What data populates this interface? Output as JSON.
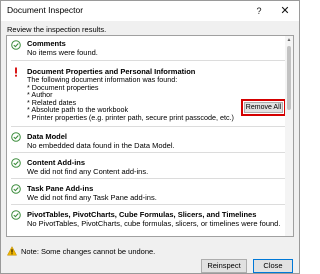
{
  "window": {
    "title": "Document Inspector",
    "help_glyph": "?",
    "close_glyph": "✕"
  },
  "instruction": "Review the inspection results.",
  "sections": [
    {
      "title": "Comments",
      "description": "No items were found.",
      "status": "ok"
    },
    {
      "title": "Document Properties and Personal Information",
      "status": "warning",
      "details": [
        "The following document information was found:",
        "* Document properties",
        "* Author",
        "* Related dates",
        "* Absolute path to the workbook",
        "* Printer properties (e.g. printer path, secure print passcode, etc.)"
      ],
      "action_label": "Remove All"
    },
    {
      "title": "Data Model",
      "description": "No embedded data found in the Data Model.",
      "status": "ok"
    },
    {
      "title": "Content Add-ins",
      "description": "We did not find any Content add-ins.",
      "status": "ok"
    },
    {
      "title": "Task Pane Add-ins",
      "description": "We did not find any Task Pane add-ins.",
      "status": "ok"
    },
    {
      "title": "PivotTables, PivotCharts, Cube Formulas, Slicers, and Timelines",
      "description": "No PivotTables, PivotCharts, cube formulas, slicers, or timelines were found.",
      "status": "ok"
    }
  ],
  "footer": {
    "note": "Note: Some changes cannot be undone."
  },
  "buttons": {
    "reinspect": "Reinspect",
    "close": "Close"
  },
  "colors": {
    "ok_green": "#3c8d3c",
    "warning_red": "#d40000",
    "highlight_border": "#d40000",
    "footer_warning_yellow": "#f0b400"
  },
  "icons": {
    "ok": "check-circle-icon",
    "warning": "exclamation-icon",
    "footer": "warning-triangle-icon"
  }
}
